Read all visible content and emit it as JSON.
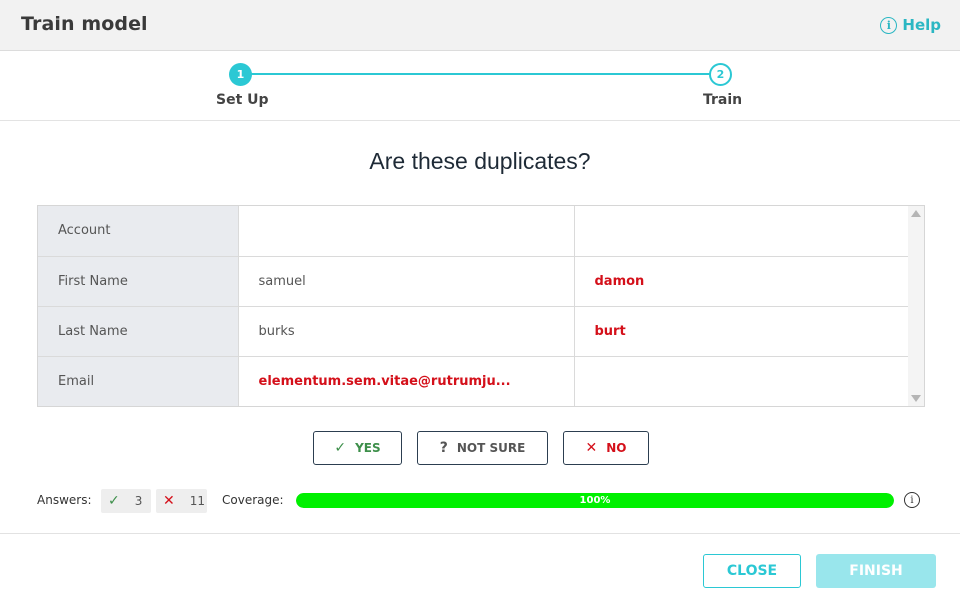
{
  "header": {
    "title": "Train model",
    "help_label": "Help"
  },
  "stepper": {
    "steps": [
      {
        "number": "1",
        "label": "Set Up",
        "state": "done"
      },
      {
        "number": "2",
        "label": "Train",
        "state": "current"
      }
    ]
  },
  "question": "Are these duplicates?",
  "comparison": {
    "rows": [
      {
        "field": "Account",
        "left": "",
        "right": "",
        "left_diff": false,
        "right_diff": false
      },
      {
        "field": "First Name",
        "left": "samuel",
        "right": "damon",
        "left_diff": false,
        "right_diff": true
      },
      {
        "field": "Last Name",
        "left": "burks",
        "right": "burt",
        "left_diff": false,
        "right_diff": true
      },
      {
        "field": "Email",
        "left": "elementum.sem.vitae@rutrumju...",
        "right": "",
        "left_diff": true,
        "right_diff": false
      }
    ]
  },
  "actions": {
    "yes_label": "YES",
    "not_sure_label": "NOT SURE",
    "no_label": "NO"
  },
  "stats": {
    "answers_label": "Answers:",
    "yes_count": "3",
    "no_count": "11",
    "coverage_label": "Coverage:",
    "coverage_text": "100%",
    "coverage_fraction": 1.0
  },
  "footer": {
    "close_label": "CLOSE",
    "finish_label": "FINISH"
  },
  "colors": {
    "accent": "#2bc8d4",
    "diff_red": "#d4101a",
    "yes_green": "#3d8f4a",
    "progress": "#00f000"
  }
}
